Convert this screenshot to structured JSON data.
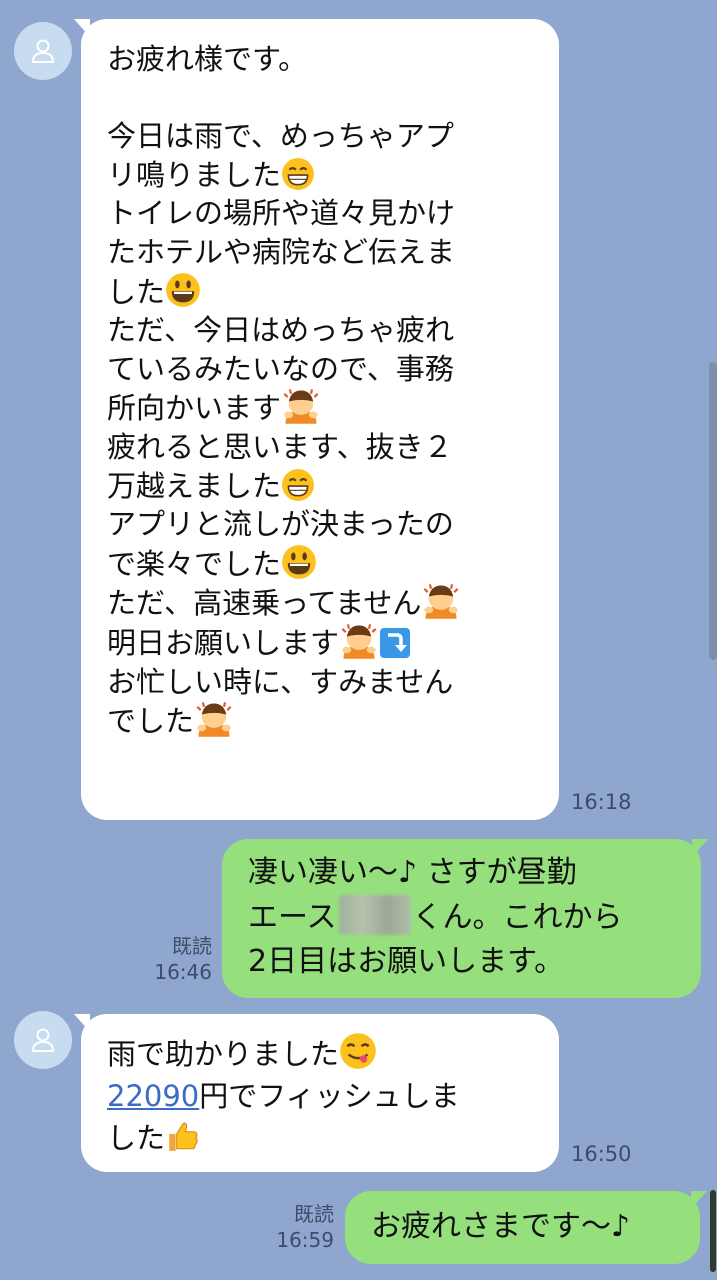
{
  "messages": [
    {
      "lines": [
        "お疲れ様です。",
        "",
        "今日は雨で、めっちゃアプ",
        "リ鳴りました",
        "トイレの場所や道々見かけ",
        "たホテルや病院など伝えま",
        "した",
        "ただ、今日はめっちゃ疲れ",
        "ているみたいなので、事務",
        "所向かいます",
        "疲れると思います、抜き２",
        "万越えました",
        "アプリと流しが決まったの",
        "で楽々でした",
        "ただ、高速乗ってません",
        "明日お願いします",
        "お忙しい時に、すみません",
        "でした"
      ],
      "time": "16:18"
    },
    {
      "lines": [
        "凄い凄い〜♪ さすが昼勤",
        "エース",
        "くん。これから",
        "2日目はお願いします。"
      ],
      "read": "既読",
      "time": "16:46"
    },
    {
      "lines": [
        "雨で助かりました",
        "22090",
        "円でフィッシュしま",
        "した"
      ],
      "time": "16:50"
    },
    {
      "lines": [
        "お疲れさまです〜♪"
      ],
      "read": "既読",
      "time": "16:59"
    }
  ],
  "colors": {
    "background": "#8fa7cf",
    "incoming_bubble": "#ffffff",
    "outgoing_bubble": "#95e07d",
    "avatar": "#c7dcef",
    "link": "#3b6bc4"
  }
}
